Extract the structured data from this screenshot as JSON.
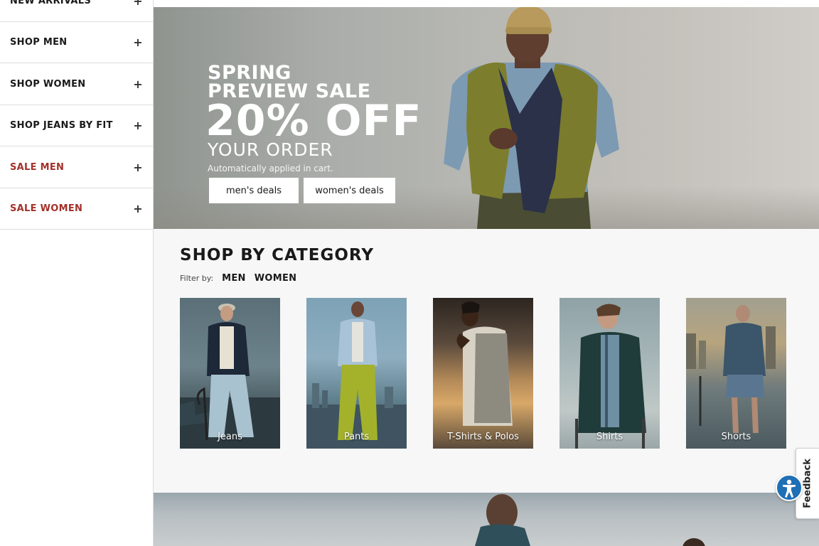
{
  "sidebar": {
    "items": [
      {
        "label": "NEW ARRIVALS",
        "sale": false
      },
      {
        "label": "SHOP MEN",
        "sale": false
      },
      {
        "label": "SHOP WOMEN",
        "sale": false
      },
      {
        "label": "SHOP JEANS BY FIT",
        "sale": false
      },
      {
        "label": "SALE MEN",
        "sale": true
      },
      {
        "label": "SALE WOMEN",
        "sale": true
      }
    ],
    "expand_symbol": "+"
  },
  "hero": {
    "line1": "SPRING",
    "line2": "PREVIEW SALE",
    "line3": "20% OFF",
    "line4": "YOUR ORDER",
    "line5": "Automatically applied in cart.",
    "buttons": [
      "men's deals",
      "women's deals"
    ]
  },
  "category": {
    "title": "SHOP BY CATEGORY",
    "filter_label": "Filter by:",
    "filter_options": [
      "MEN",
      "WOMEN"
    ],
    "tiles": [
      "Jeans",
      "Pants",
      "T-Shirts & Polos",
      "Shirts",
      "Shorts"
    ]
  },
  "feedback": {
    "label": "Feedback"
  },
  "colors": {
    "sale_red": "#a3302a",
    "accessibility_blue": "#1f6fb5"
  }
}
